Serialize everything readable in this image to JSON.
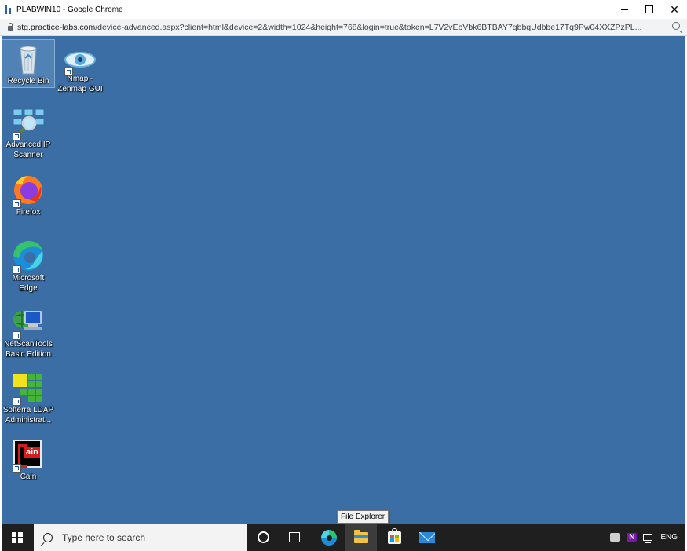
{
  "window": {
    "title": "PLABWIN10 - Google Chrome",
    "url_host": "stg.practice-labs.com",
    "url_path": "/device-advanced.aspx?client=html&device=2&width=1024&height=768&login=true&token=L7V2vEbVbk6BTBAY7qbbqUdbbe17Tq9Pw04XXZPzPL..."
  },
  "desktop": {
    "icons": [
      {
        "label_1": "Recycle Bin",
        "label_2": ""
      },
      {
        "label_1": "Nmap -",
        "label_2": "Zenmap GUI"
      },
      {
        "label_1": "Advanced IP",
        "label_2": "Scanner"
      },
      {
        "label_1": "Firefox",
        "label_2": ""
      },
      {
        "label_1": "Microsoft",
        "label_2": "Edge"
      },
      {
        "label_1": "NetScanTools",
        "label_2": "Basic Edition"
      },
      {
        "label_1": "Softerra LDAP",
        "label_2": "Administrat..."
      },
      {
        "label_1": "Cain",
        "label_2": ""
      }
    ],
    "cain_logo_text": "ain"
  },
  "taskbar": {
    "search_placeholder": "Type here to search",
    "tooltip": "File Explorer",
    "language": "ENG",
    "onenote_letter": "N"
  },
  "colors": {
    "desktop_bg": "#3a6ea5",
    "taskbar_bg": "#1f1f1f"
  },
  "icons": [
    "minimize-icon",
    "maximize-icon",
    "close-icon",
    "lock-icon",
    "zoom-icon",
    "recycle-bin-icon",
    "nmap-eye-icon",
    "advanced-ip-scanner-icon",
    "firefox-icon",
    "edge-icon",
    "netscantools-icon",
    "softerra-ldap-icon",
    "cain-icon",
    "windows-logo-icon",
    "search-icon",
    "cortana-icon",
    "task-view-icon",
    "file-explorer-icon",
    "store-icon",
    "mail-icon"
  ]
}
